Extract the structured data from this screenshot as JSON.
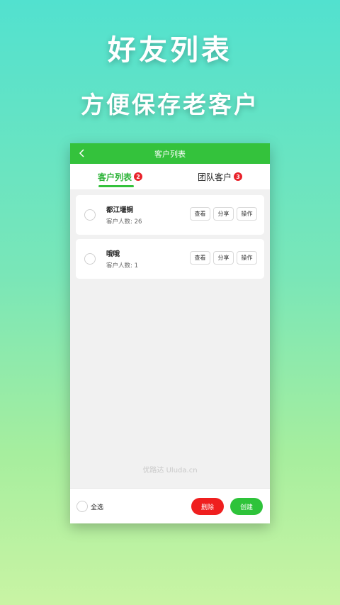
{
  "promo": {
    "title": "好友列表",
    "subtitle": "方便保存老客户"
  },
  "nav": {
    "title": "客户列表",
    "back_icon": "chevron-left-icon"
  },
  "tabs": [
    {
      "label": "客户列表",
      "badge": "2",
      "active": true
    },
    {
      "label": "团队客户",
      "badge": "3",
      "active": false
    }
  ],
  "customers": [
    {
      "name": "都江堰铜",
      "count": "客户人数: 26"
    },
    {
      "name": "哦哦",
      "count": "客户人数: 1"
    }
  ],
  "card_actions": {
    "view": "查看",
    "share": "分享",
    "operate": "操作"
  },
  "watermark": "优路达 Uluda.cn",
  "bottom": {
    "select_all": "全选",
    "delete": "删除",
    "create": "创建"
  },
  "colors": {
    "primary": "#34c23c",
    "danger": "#ef1f1f",
    "badge": "#e9222a"
  }
}
